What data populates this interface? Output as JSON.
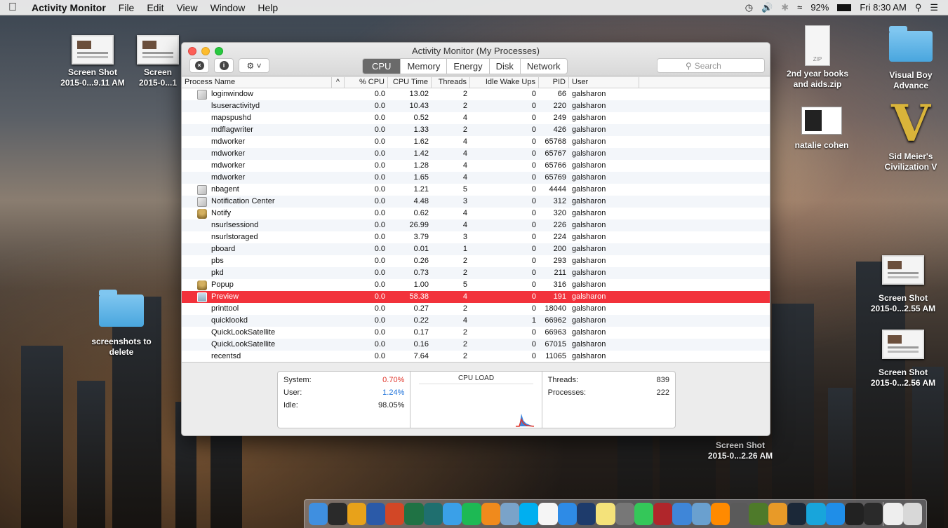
{
  "menubar": {
    "apple": "",
    "app": "Activity Monitor",
    "menus": [
      "File",
      "Edit",
      "View",
      "Window",
      "Help"
    ],
    "battery": "92%",
    "clock": "Fri 8:30 AM"
  },
  "desktop_icons": [
    {
      "id": "ss1",
      "line1": "Screen Shot",
      "line2": "2015-0...9.11 AM"
    },
    {
      "id": "ss2",
      "line1": "Screen",
      "line2": "2015-0...1"
    },
    {
      "id": "zip",
      "line1": "2nd year books",
      "line2": "and aids.zip",
      "badge": "ZIP"
    },
    {
      "id": "vba",
      "line1": "Visual Boy",
      "line2": "Advance"
    },
    {
      "id": "natalie",
      "line1": "natalie cohen",
      "line2": ""
    },
    {
      "id": "civ",
      "line1": "Sid Meier's",
      "line2": "Civilization V",
      "glyph": "V"
    },
    {
      "id": "screens",
      "line1": "screenshots to",
      "line2": "delete"
    },
    {
      "id": "ss3",
      "line1": "Screen Shot",
      "line2": "2015-0...2.55 AM"
    },
    {
      "id": "ss4",
      "line1": "Screen Shot",
      "line2": "2015-0...2.56 AM"
    },
    {
      "id": "ss5",
      "line1": "Screen Shot",
      "line2": "2015-0...2.26 AM"
    }
  ],
  "window": {
    "title": "Activity Monitor (My Processes)",
    "toolbar": {
      "close_glyph": "×",
      "info_glyph": "i",
      "gear_glyph": "⚙ ˅"
    },
    "tabs": [
      "CPU",
      "Memory",
      "Energy",
      "Disk",
      "Network"
    ],
    "active_tab": "CPU",
    "search_placeholder": "Search",
    "columns": [
      "Process Name",
      "% CPU",
      "CPU Time",
      "Threads",
      "Idle Wake Ups",
      "PID",
      "User"
    ],
    "sort_glyph": "^",
    "rows": [
      {
        "name": "loginwindow",
        "cpu": "0.0",
        "time": "13.02",
        "threads": "2",
        "idle": "0",
        "pid": "66",
        "user": "galsharon",
        "icon": "doc"
      },
      {
        "name": "lsuseractivityd",
        "cpu": "0.0",
        "time": "10.43",
        "threads": "2",
        "idle": "0",
        "pid": "220",
        "user": "galsharon",
        "icon": "none"
      },
      {
        "name": "mapspushd",
        "cpu": "0.0",
        "time": "0.52",
        "threads": "4",
        "idle": "0",
        "pid": "249",
        "user": "galsharon",
        "icon": "none"
      },
      {
        "name": "mdflagwriter",
        "cpu": "0.0",
        "time": "1.33",
        "threads": "2",
        "idle": "0",
        "pid": "426",
        "user": "galsharon",
        "icon": "none"
      },
      {
        "name": "mdworker",
        "cpu": "0.0",
        "time": "1.62",
        "threads": "4",
        "idle": "0",
        "pid": "65768",
        "user": "galsharon",
        "icon": "none"
      },
      {
        "name": "mdworker",
        "cpu": "0.0",
        "time": "1.42",
        "threads": "4",
        "idle": "0",
        "pid": "65767",
        "user": "galsharon",
        "icon": "none"
      },
      {
        "name": "mdworker",
        "cpu": "0.0",
        "time": "1.28",
        "threads": "4",
        "idle": "0",
        "pid": "65766",
        "user": "galsharon",
        "icon": "none"
      },
      {
        "name": "mdworker",
        "cpu": "0.0",
        "time": "1.65",
        "threads": "4",
        "idle": "0",
        "pid": "65769",
        "user": "galsharon",
        "icon": "none"
      },
      {
        "name": "nbagent",
        "cpu": "0.0",
        "time": "1.21",
        "threads": "5",
        "idle": "0",
        "pid": "4444",
        "user": "galsharon",
        "icon": "doc"
      },
      {
        "name": "Notification Center",
        "cpu": "0.0",
        "time": "4.48",
        "threads": "3",
        "idle": "0",
        "pid": "312",
        "user": "galsharon",
        "icon": "doc"
      },
      {
        "name": "Notify",
        "cpu": "0.0",
        "time": "0.62",
        "threads": "4",
        "idle": "0",
        "pid": "320",
        "user": "galsharon",
        "icon": "pop"
      },
      {
        "name": "nsurlsessiond",
        "cpu": "0.0",
        "time": "26.99",
        "threads": "4",
        "idle": "0",
        "pid": "226",
        "user": "galsharon",
        "icon": "none"
      },
      {
        "name": "nsurlstoraged",
        "cpu": "0.0",
        "time": "3.79",
        "threads": "3",
        "idle": "0",
        "pid": "224",
        "user": "galsharon",
        "icon": "none"
      },
      {
        "name": "pboard",
        "cpu": "0.0",
        "time": "0.01",
        "threads": "1",
        "idle": "0",
        "pid": "200",
        "user": "galsharon",
        "icon": "none"
      },
      {
        "name": "pbs",
        "cpu": "0.0",
        "time": "0.26",
        "threads": "2",
        "idle": "0",
        "pid": "293",
        "user": "galsharon",
        "icon": "none"
      },
      {
        "name": "pkd",
        "cpu": "0.0",
        "time": "0.73",
        "threads": "2",
        "idle": "0",
        "pid": "211",
        "user": "galsharon",
        "icon": "none"
      },
      {
        "name": "Popup",
        "cpu": "0.0",
        "time": "1.00",
        "threads": "5",
        "idle": "0",
        "pid": "316",
        "user": "galsharon",
        "icon": "pop"
      },
      {
        "name": "Preview",
        "cpu": "0.0",
        "time": "58.38",
        "threads": "4",
        "idle": "0",
        "pid": "191",
        "user": "galsharon",
        "icon": "prev",
        "selected": true
      },
      {
        "name": "printtool",
        "cpu": "0.0",
        "time": "0.27",
        "threads": "2",
        "idle": "0",
        "pid": "18040",
        "user": "galsharon",
        "icon": "none"
      },
      {
        "name": "quicklookd",
        "cpu": "0.0",
        "time": "0.22",
        "threads": "4",
        "idle": "1",
        "pid": "66962",
        "user": "galsharon",
        "icon": "none"
      },
      {
        "name": "QuickLookSatellite",
        "cpu": "0.0",
        "time": "0.17",
        "threads": "2",
        "idle": "0",
        "pid": "66963",
        "user": "galsharon",
        "icon": "none"
      },
      {
        "name": "QuickLookSatellite",
        "cpu": "0.0",
        "time": "0.16",
        "threads": "2",
        "idle": "0",
        "pid": "67015",
        "user": "galsharon",
        "icon": "none"
      },
      {
        "name": "recentsd",
        "cpu": "0.0",
        "time": "7.64",
        "threads": "2",
        "idle": "0",
        "pid": "11065",
        "user": "galsharon",
        "icon": "none"
      }
    ],
    "stats": {
      "system_label": "System:",
      "system_value": "0.70%",
      "user_label": "User:",
      "user_value": "1.24%",
      "idle_label": "Idle:",
      "idle_value": "98.05%",
      "cpuload_title": "CPU LOAD",
      "threads_label": "Threads:",
      "threads_value": "839",
      "processes_label": "Processes:",
      "processes_value": "222"
    }
  },
  "dock": [
    {
      "name": "finder",
      "color": "#3f8fe0"
    },
    {
      "name": "dashboard",
      "color": "#2a2a2a"
    },
    {
      "name": "chrome",
      "color": "#e8a21a"
    },
    {
      "name": "word",
      "color": "#2b5aa8"
    },
    {
      "name": "powerpoint",
      "color": "#d24726"
    },
    {
      "name": "excel",
      "color": "#1f7244"
    },
    {
      "name": "quark",
      "color": "#1f6f6f"
    },
    {
      "name": "itunes",
      "color": "#3aa0e8"
    },
    {
      "name": "spotify",
      "color": "#1db954"
    },
    {
      "name": "vlc",
      "color": "#f08a1c"
    },
    {
      "name": "preview",
      "color": "#7aa3c9"
    },
    {
      "name": "skype",
      "color": "#00aff0"
    },
    {
      "name": "calendar",
      "color": "#f5f5f5"
    },
    {
      "name": "safari",
      "color": "#2e8be6"
    },
    {
      "name": "league",
      "color": "#1e3b6b"
    },
    {
      "name": "notes",
      "color": "#f4e27a"
    },
    {
      "name": "system-prefs",
      "color": "#777777"
    },
    {
      "name": "facetime",
      "color": "#34c759"
    },
    {
      "name": "photo-booth",
      "color": "#b0262b"
    },
    {
      "name": "app-store",
      "color": "#3f86d8"
    },
    {
      "name": "preview2",
      "color": "#6aa0cf"
    },
    {
      "name": "vox",
      "color": "#ff8a00"
    },
    {
      "name": "launchpad",
      "color": "#5a5a5a"
    },
    {
      "name": "minecraft",
      "color": "#4e7a2a"
    },
    {
      "name": "overwatch",
      "color": "#e89a28"
    },
    {
      "name": "steam",
      "color": "#1b2838"
    },
    {
      "name": "app1",
      "color": "#18a5db"
    },
    {
      "name": "app2",
      "color": "#1f8ee8"
    },
    {
      "name": "airplay",
      "color": "#222222"
    },
    {
      "name": "activity-monitor",
      "color": "#2a2a2a"
    },
    {
      "name": "document",
      "color": "#eeeeee"
    },
    {
      "name": "trash",
      "color": "#d8d8d8"
    }
  ]
}
